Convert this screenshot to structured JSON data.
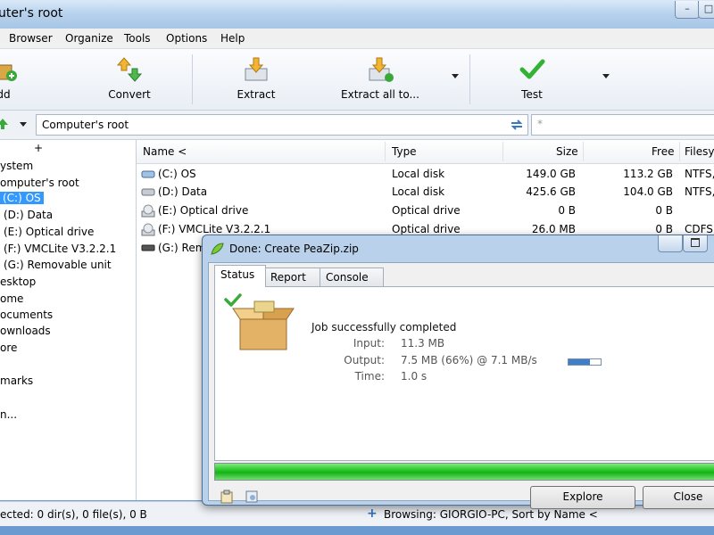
{
  "window": {
    "title": "uter's root"
  },
  "menu": [
    "Browser",
    "Organize",
    "Tools",
    "Options",
    "Help"
  ],
  "toolbar": {
    "add_label": "dd",
    "convert_label": "Convert",
    "extract_label": "Extract",
    "extract_all_label": "Extract all to...",
    "test_label": "Test"
  },
  "address": {
    "value": "Computer's root",
    "search_placeholder": "*"
  },
  "tree": {
    "items": [
      "+",
      "ystem",
      "omputer's root",
      "(C:) OS",
      "(D:) Data",
      "(E:) Optical drive",
      "(F:) VMCLite V3.2.2.1",
      "(G:) Removable unit",
      "esktop",
      "ome",
      "ocuments",
      "ownloads",
      "ore",
      "marks",
      "n..."
    ]
  },
  "list": {
    "columns": [
      "Name <",
      "Type",
      "Size",
      "Free",
      "Filesy"
    ],
    "rows": [
      {
        "name": "(C:) OS",
        "type": "Local disk",
        "size": "149.0 GB",
        "free": "113.2 GB",
        "fs": "NTFS,"
      },
      {
        "name": "(D:) Data",
        "type": "Local disk",
        "size": "425.6 GB",
        "free": "104.0 GB",
        "fs": "NTFS,"
      },
      {
        "name": "(E:) Optical drive",
        "type": "Optical drive",
        "size": "0 B",
        "free": "0 B",
        "fs": ""
      },
      {
        "name": "(F:) VMCLite V3.2.2.1",
        "type": "Optical drive",
        "size": "26.0 MB",
        "free": "0 B",
        "fs": "CDFS"
      },
      {
        "name": "(G:) Rem",
        "type": "",
        "size": "",
        "free": "",
        "fs": ""
      }
    ]
  },
  "status": {
    "left": "ected: 0 dir(s), 0 file(s), 0 B",
    "right": "Browsing: GIORGIO-PC, Sort by Name <"
  },
  "dialog": {
    "title": "Done: Create PeaZip.zip",
    "tabs": [
      "Status",
      "Report",
      "Console"
    ],
    "message": "Job successfully completed",
    "input_label": "Input:",
    "input_value": "11.3 MB",
    "output_label": "Output:",
    "output_value": "7.5 MB (66%) @ 7.1 MB/s",
    "time_label": "Time:",
    "time_value": "1.0 s",
    "ratio_fraction": 0.66,
    "progress_fraction": 1.0,
    "explore_label": "Explore",
    "close_label": "Close"
  },
  "colors": {
    "selection": "#3399ff",
    "progress": "#1fc21f",
    "titlebar": "#b6d1ec"
  }
}
